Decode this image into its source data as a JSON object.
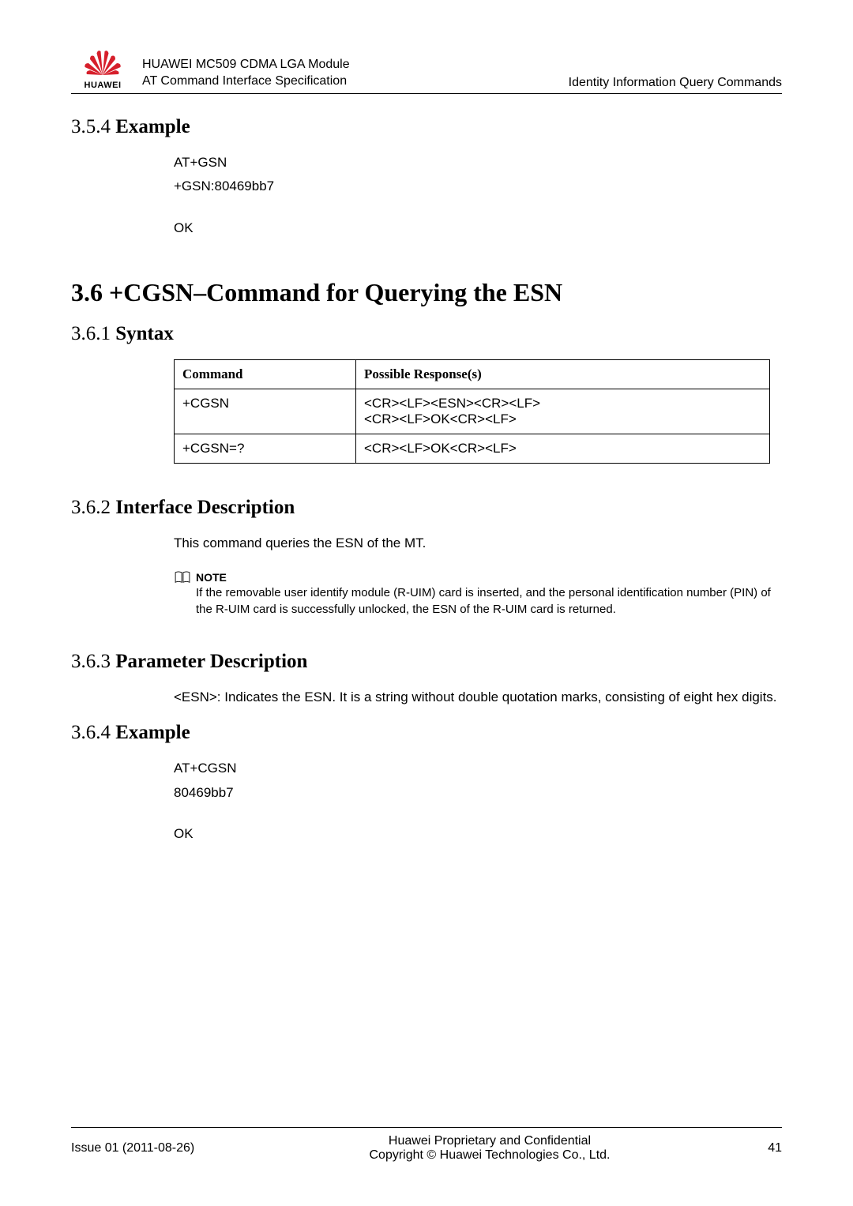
{
  "header": {
    "logo_brand": "HUAWEI",
    "title_line1": "HUAWEI MC509 CDMA LGA Module",
    "title_line2": "AT Command Interface Specification",
    "right_text": "Identity Information Query Commands"
  },
  "sections": {
    "s354": {
      "num": "3.5.4 ",
      "title": "Example",
      "lines": [
        "AT+GSN",
        "+GSN:80469bb7",
        "",
        "OK"
      ]
    },
    "s36": {
      "title": "3.6 +CGSN–Command for Querying the ESN"
    },
    "s361": {
      "num": "3.6.1 ",
      "title": "Syntax",
      "table": {
        "headers": [
          "Command",
          "Possible Response(s)"
        ],
        "rows": [
          {
            "cmd": "+CGSN",
            "resp": [
              "<CR><LF><ESN><CR><LF>",
              "<CR><LF>OK<CR><LF>"
            ]
          },
          {
            "cmd": "+CGSN=?",
            "resp": [
              "<CR><LF>OK<CR><LF>"
            ]
          }
        ]
      }
    },
    "s362": {
      "num": "3.6.2 ",
      "title": "Interface Description",
      "body": "This command queries the ESN of the MT.",
      "note_label": "NOTE",
      "note_text": "If the removable user identify module (R-UIM) card is inserted, and the personal identification number (PIN) of the R-UIM card is successfully unlocked, the ESN of the R-UIM card is returned."
    },
    "s363": {
      "num": "3.6.3 ",
      "title": "Parameter Description",
      "body": "<ESN>: Indicates the ESN. It is a string without double quotation marks, consisting of eight hex digits."
    },
    "s364": {
      "num": "3.6.4 ",
      "title": "Example",
      "lines": [
        "AT+CGSN",
        "80469bb7",
        "",
        "OK"
      ]
    }
  },
  "footer": {
    "left": "Issue 01 (2011-08-26)",
    "center_line1": "Huawei Proprietary and Confidential",
    "center_line2": "Copyright © Huawei Technologies Co., Ltd.",
    "right": "41"
  }
}
